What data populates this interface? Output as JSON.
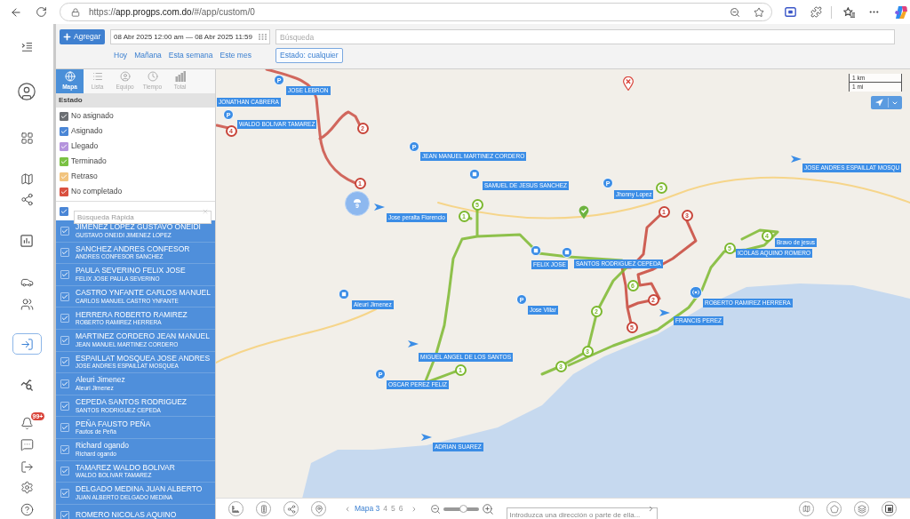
{
  "browser": {
    "url": {
      "scheme": "https://",
      "host": "app.progps.com.do",
      "path": "/#/app/custom/0"
    }
  },
  "nav": {
    "items": [
      {
        "kind": "collapse",
        "selected": false
      },
      {
        "kind": "profile",
        "selected": false
      },
      {
        "kind": "dashboard",
        "selected": false
      },
      {
        "kind": "map",
        "selected": false
      },
      {
        "kind": "share",
        "selected": false
      },
      {
        "kind": "reports",
        "selected": false
      },
      {
        "kind": "vehicles",
        "selected": false
      },
      {
        "kind": "groups",
        "selected": false
      },
      {
        "kind": "import",
        "selected": true
      },
      {
        "kind": "analytics",
        "selected": false
      },
      {
        "kind": "notifications",
        "selected": false,
        "badge": "99+"
      },
      {
        "kind": "messages",
        "selected": false
      },
      {
        "kind": "exit",
        "selected": false
      },
      {
        "kind": "settings",
        "selected": false
      },
      {
        "kind": "help",
        "selected": false
      }
    ]
  },
  "toolbar": {
    "add_button": "Agregar",
    "date_range": "08 Abr 2025 12:00 am — 08 Abr 2025 11:59",
    "search": {
      "placeholder": "Búsqueda"
    },
    "quick_dates": [
      "Hoy",
      "Mañana",
      "Esta semana",
      "Este mes"
    ],
    "status_filter": "Estado: cualquier"
  },
  "panel": {
    "tabs": [
      {
        "label": "Mapa",
        "kind": "map",
        "selected": true
      },
      {
        "label": "Lista",
        "kind": "list",
        "selected": false
      },
      {
        "label": "Equipo",
        "kind": "team",
        "selected": false
      },
      {
        "label": "Tiempo",
        "kind": "time",
        "selected": false
      },
      {
        "label": "Total",
        "kind": "total",
        "selected": false
      }
    ],
    "status_header": "Estado",
    "statuses": [
      {
        "label": "No asignado",
        "color": "#6b6e73",
        "checked": true
      },
      {
        "label": "Asignado",
        "color": "#4a86d6",
        "checked": true
      },
      {
        "label": "Llegado",
        "color": "#b594dd",
        "checked": true
      },
      {
        "label": "Terminado",
        "color": "#7ac143",
        "checked": true
      },
      {
        "label": "Retraso",
        "color": "#f2c47e",
        "checked": true
      },
      {
        "label": "No completado",
        "color": "#d9503f",
        "checked": true
      }
    ],
    "quick_search": {
      "checked": true,
      "placeholder": "Búsqueda Rápida"
    },
    "drivers": [
      {
        "name": "JIMENEZ LOPEZ GUSTAVO ONEIDI",
        "subtitle": "GUSTAVO ONEIDI JIMENEZ LOPEZ",
        "checked": true
      },
      {
        "name": "SANCHEZ ANDRES CONFESOR",
        "subtitle": "ANDRES CONFESOR SANCHEZ",
        "checked": true
      },
      {
        "name": "PAULA SEVERINO FELIX JOSE",
        "subtitle": "FELIX JOSE PAULA SEVERINO",
        "checked": true
      },
      {
        "name": "CASTRO YNFANTE CARLOS MANUEL",
        "subtitle": "CARLOS MANUEL CASTRO YNFANTE",
        "checked": true
      },
      {
        "name": "HERRERA ROBERTO RAMIREZ",
        "subtitle": "ROBERTO RAMIREZ HERRERA",
        "checked": true
      },
      {
        "name": "MARTINEZ CORDERO JEAN MANUEL",
        "subtitle": "JEAN MANUEL MARTINEZ CORDERO",
        "checked": true
      },
      {
        "name": "ESPAILLAT MOSQUEA JOSE ANDRES",
        "subtitle": "JOSE ANDRES ESPAILLAT MOSQUEA",
        "checked": true
      },
      {
        "name": "Aleuri Jimenez",
        "subtitle": "Aleuri Jimenez",
        "checked": true
      },
      {
        "name": "CEPEDA SANTOS RODRIGUEZ",
        "subtitle": "SANTOS RODRIGUEZ CEPEDA",
        "checked": true
      },
      {
        "name": "PEÑA FAUSTO PEÑA",
        "subtitle": "Fautos de Peña",
        "checked": true
      },
      {
        "name": "Richard ogando",
        "subtitle": "Richard ogando",
        "checked": true
      },
      {
        "name": "TAMAREZ WALDO BOLIVAR",
        "subtitle": "WALDO BOLIVAR TAMAREZ",
        "checked": true
      },
      {
        "name": "DELGADO MEDINA JUAN ALBERTO",
        "subtitle": "JUAN ALBERTO DELGADO MEDINA",
        "checked": true
      },
      {
        "name": "ROMERO NICOLAS AQUINO",
        "checked": true
      }
    ]
  },
  "map": {
    "scale": [
      "1 km",
      "1 mi"
    ],
    "cluster": {
      "count": "9"
    },
    "stops": [
      {
        "number": "4",
        "color": "#c8453a"
      },
      {
        "number": "2",
        "color": "#c8453a"
      },
      {
        "number": "1",
        "color": "#c8453a"
      },
      {
        "number": "1",
        "color": "#c8453a"
      },
      {
        "number": "3",
        "color": "#c8453a"
      },
      {
        "number": "2",
        "color": "#c8453a"
      },
      {
        "number": "5",
        "color": "#c8453a"
      },
      {
        "number": "5",
        "color": "#7cb82f"
      },
      {
        "number": "1",
        "color": "#7cb82f"
      },
      {
        "number": "5",
        "color": "#7cb82f"
      },
      {
        "number": "5",
        "color": "#7cb82f"
      },
      {
        "number": "4",
        "color": "#7cb82f"
      },
      {
        "number": "6",
        "color": "#7cb82f"
      },
      {
        "number": "2",
        "color": "#7cb82f"
      },
      {
        "number": "3",
        "color": "#7cb82f"
      },
      {
        "number": "3",
        "color": "#7cb82f"
      },
      {
        "number": "1",
        "color": "#7cb82f"
      }
    ],
    "units": [
      {
        "kind": "parking",
        "pin_text": "P",
        "label": "JOSE LEBRON"
      },
      {
        "kind": "label",
        "label": "JONATHAN CABRERA"
      },
      {
        "kind": "parking",
        "pin_text": "P",
        "label": "WALDO BOLIVAR TAMAREZ"
      },
      {
        "kind": "parking",
        "pin_text": "P",
        "label": "JEAN MANUEL MARTINEZ CORDERO"
      },
      {
        "kind": "arrow",
        "label": "JOSE ANDRES ESPAILLAT MOSQU"
      },
      {
        "kind": "square",
        "label": "SAMUEL DE JESUS SANCHEZ"
      },
      {
        "kind": "parking",
        "pin_text": "P",
        "label": "Jhonny Lopez"
      },
      {
        "kind": "arrow",
        "label": "Jose peralta Florencio"
      },
      {
        "kind": "label",
        "label": "Bravo de jesus"
      },
      {
        "kind": "label",
        "label": "ICOLAS AQUINO ROMERO"
      },
      {
        "kind": "square",
        "label": "FELIX JOSE"
      },
      {
        "kind": "square",
        "label": "SANTOS RODRIGUEZ CEPEDA"
      },
      {
        "kind": "square",
        "label": "Aleuri Jimenez"
      },
      {
        "kind": "parking",
        "pin_text": "P",
        "label": "Jose Villar"
      },
      {
        "kind": "broadcast",
        "label": "ROBERTO RAMIREZ HERRERA"
      },
      {
        "kind": "arrow",
        "label": "FRANCIS PEREZ"
      },
      {
        "kind": "arrow",
        "label": "MIGUEL ANGEL DE LOS SANTOS"
      },
      {
        "kind": "parking",
        "pin_text": "P",
        "label": "OSCAR PEREZ FELIZ"
      },
      {
        "kind": "arrow",
        "label": "ADRIAN SUAREZ"
      }
    ]
  },
  "bottom_bar": {
    "pages": [
      {
        "label": "Mapa 3",
        "selected": true
      },
      {
        "label": "4",
        "selected": false
      },
      {
        "label": "5",
        "selected": false
      },
      {
        "label": "6",
        "selected": false
      }
    ],
    "zoom": {
      "level": 0.57
    },
    "address": {
      "placeholder": "Introduzca una dirección o parte de ella..."
    }
  }
}
